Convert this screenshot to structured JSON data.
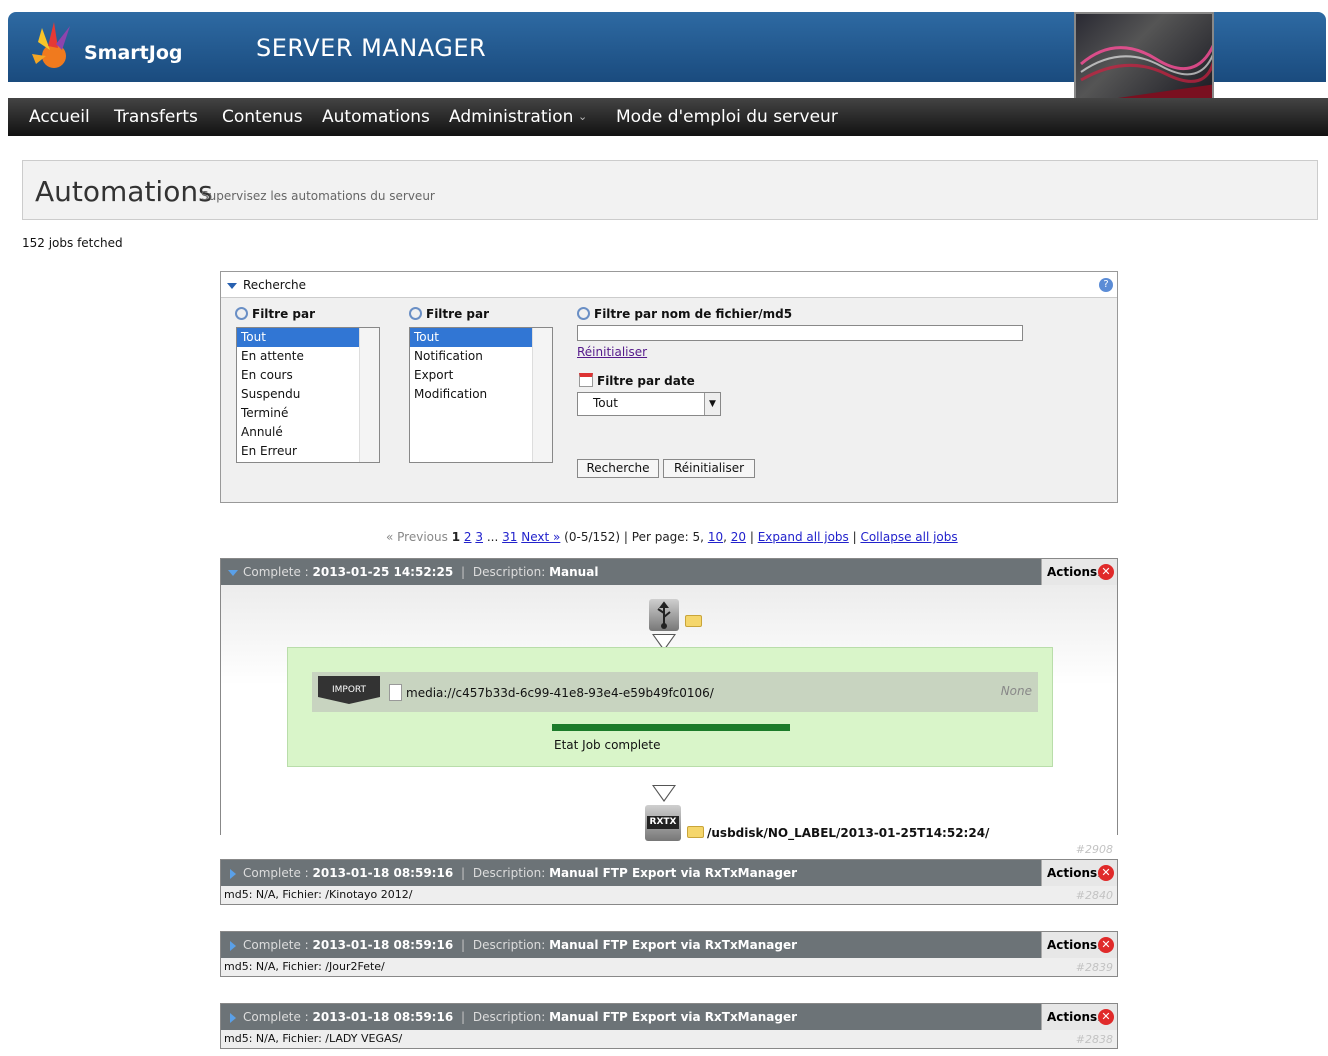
{
  "app": {
    "logo_text": "SmartJog",
    "title": "SERVER MANAGER"
  },
  "nav": {
    "items": [
      "Accueil",
      "Transferts",
      "Contenus",
      "Automations",
      "Administration",
      "Mode d'emploi du serveur"
    ]
  },
  "page": {
    "title": "Automations",
    "subtitle": "Supervisez les automations du serveur",
    "fetched": "152 jobs fetched"
  },
  "search": {
    "title": "Recherche",
    "filter1_label": "Filtre par",
    "filter1_options": [
      "Tout",
      "En attente",
      "En cours",
      "Suspendu",
      "Terminé",
      "Annulé",
      "En Erreur"
    ],
    "filter2_label": "Filtre par",
    "filter2_options": [
      "Tout",
      "Notification",
      "Export",
      "Modification"
    ],
    "filename_label": "Filtre par nom de fichier/md5",
    "filename_value": "",
    "reset_link": "Réinitialiser",
    "date_label": "Filtre par date",
    "date_value": "Tout",
    "search_button": "Recherche",
    "reset_button": "Réinitialiser"
  },
  "pager": {
    "previous": "« Previous",
    "current": "1",
    "pages": [
      "2",
      "3"
    ],
    "ellipsis": "...",
    "last": "31",
    "next": "Next »",
    "range": "(0-5/152)",
    "per_page_label": "Per page:",
    "per_page_current": "5,",
    "per_page_options": [
      "10",
      "20"
    ],
    "expand": "Expand all jobs",
    "collapse": "Collapse all jobs"
  },
  "jobs": [
    {
      "status": "Complete :",
      "date": "2013-01-25 14:52:25",
      "desc_label": "Description:",
      "description": "Manual",
      "actions": "Actions:",
      "id": "#2908",
      "step_badge": "IMPORT",
      "step_uri": "media://c457b33d-6c99-41e8-93e4-e59b49fc0106/",
      "step_status": "None",
      "progress": 1.0,
      "state": "Etat Job complete",
      "dest_badge": "RXTX",
      "destination": "/usbdisk/NO_LABEL/2013-01-25T14:52:24/"
    },
    {
      "status": "Complete :",
      "date": "2013-01-18 08:59:16",
      "desc_label": "Description:",
      "description": "Manual FTP Export via RxTxManager",
      "actions": "Actions:",
      "detail": "md5: N/A, Fichier: /Kinotayo 2012/",
      "id": "#2840"
    },
    {
      "status": "Complete :",
      "date": "2013-01-18 08:59:16",
      "desc_label": "Description:",
      "description": "Manual FTP Export via RxTxManager",
      "actions": "Actions:",
      "detail": "md5: N/A, Fichier: /Jour2Fete/",
      "id": "#2839"
    },
    {
      "status": "Complete :",
      "date": "2013-01-18 08:59:16",
      "desc_label": "Description:",
      "description": "Manual FTP Export via RxTxManager",
      "actions": "Actions:",
      "detail": "md5: N/A, Fichier: /LADY VEGAS/",
      "id": "#2838"
    }
  ],
  "colors": {
    "header": "#1a4b7e",
    "nav": "#1a1a1a",
    "job_header": "#6c7377",
    "progress": "#1c7b2a",
    "panel_green": "#d9f5c9"
  }
}
